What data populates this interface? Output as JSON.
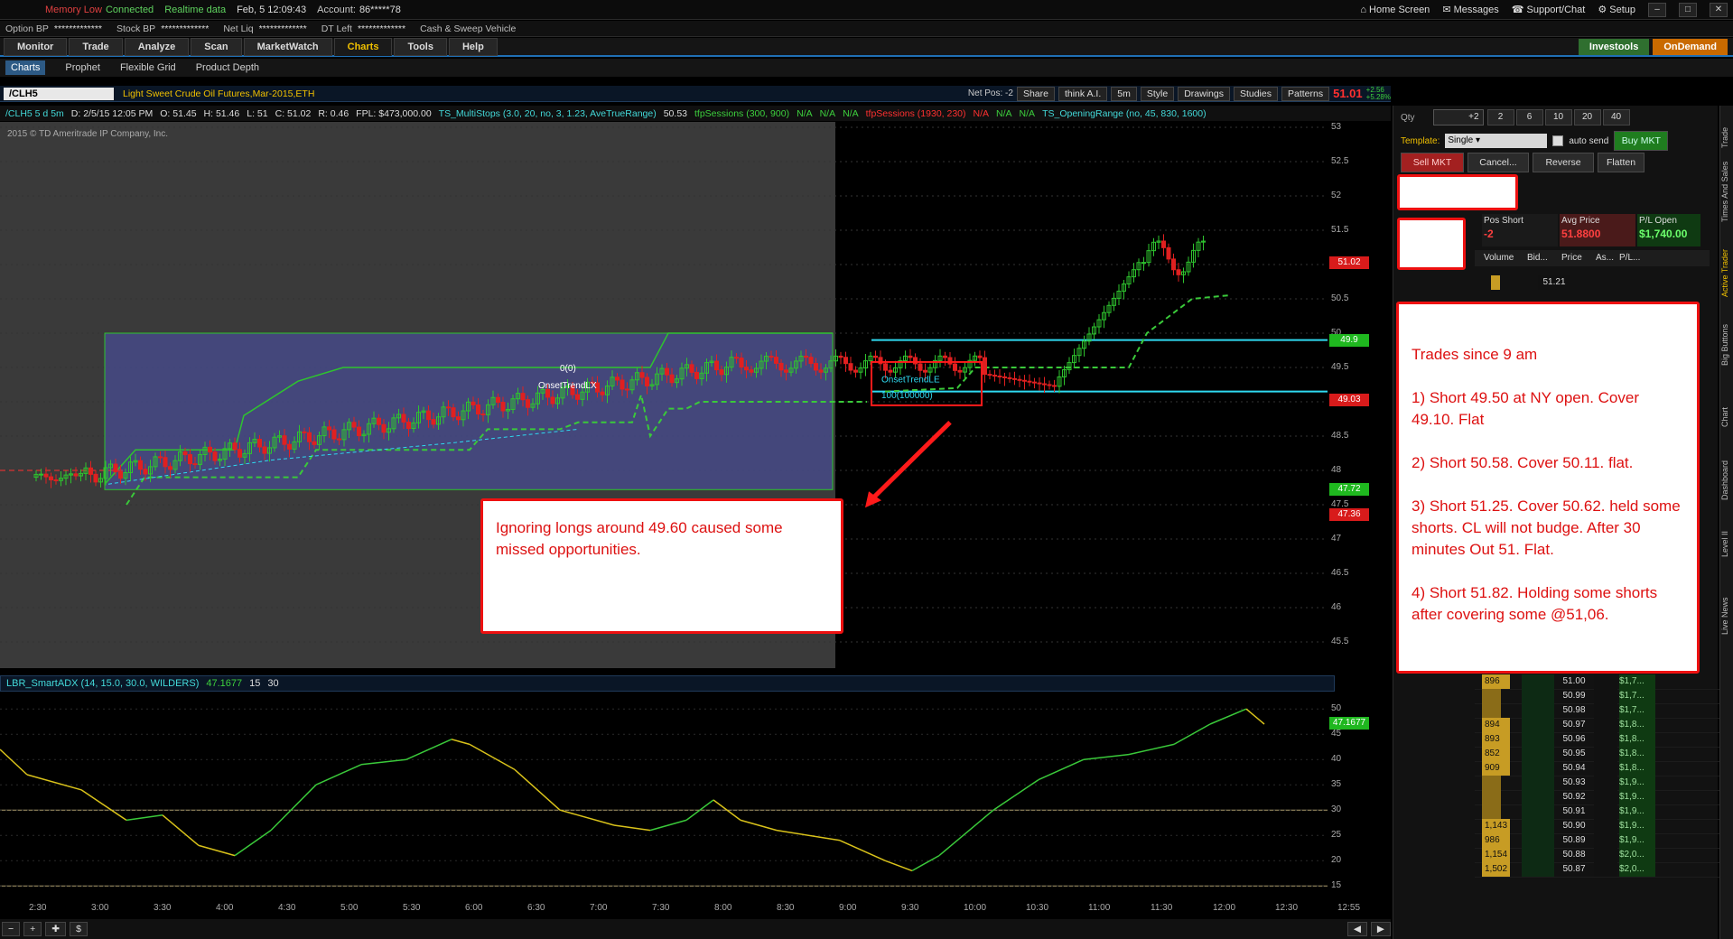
{
  "top_bar": {
    "memory": "Memory Low",
    "connected": "Connected",
    "realtime": "Realtime data",
    "datetime": "Feb, 5  12:09:43",
    "account_label": "Account:",
    "account": "86*****78",
    "home": "Home Screen",
    "messages": "Messages",
    "support": "Support/Chat",
    "setup": "Setup"
  },
  "account_bar": [
    {
      "label": "Option BP",
      "value": "*************"
    },
    {
      "label": "Stock BP",
      "value": "*************"
    },
    {
      "label": "Net Liq",
      "value": "*************"
    },
    {
      "label": "DT Left",
      "value": "*************"
    },
    {
      "label": "Cash & Sweep Vehicle",
      "value": ""
    }
  ],
  "main_tabs": [
    "Monitor",
    "Trade",
    "Analyze",
    "Scan",
    "MarketWatch",
    "Charts",
    "Tools",
    "Help"
  ],
  "active_tab": "Charts",
  "brand": {
    "investools": "Investools",
    "ondemand": "OnDemand"
  },
  "sub_tabs": [
    "Charts",
    "Prophet",
    "Flexible Grid",
    "Product Depth"
  ],
  "symbol_bar": {
    "symbol": "/CLH5",
    "description": "Light Sweet Crude Oil Futures,Mar-2015,ETH",
    "net_pos": "Net Pos: -2",
    "share": "Share",
    "thinkai": "think A.I.",
    "interval": "5m",
    "style": "Style",
    "drawings": "Drawings",
    "studies": "Studies",
    "patterns": "Patterns",
    "last": "51.01",
    "chg1": "+2.56",
    "chg2": "+5.28%"
  },
  "study_bar": {
    "sym": "/CLH5 5 d 5m",
    "d": "D: 2/5/15 12:05 PM",
    "o": "O: 51.45",
    "h": "H: 51.46",
    "l": "L: 51",
    "c": "C: 51.02",
    "r": "R: 0.46",
    "fpl": "FPL: $473,000.00",
    "ts1": "TS_MultiStops (3.0, 20, no, 3, 1.23, AveTrueRange)",
    "ts1v": "50.53",
    "tfp1": "tfpSessions (300, 900)",
    "na": "N/A",
    "tfp2": "tfpSessions (1930, 230)",
    "or": "TS_OpeningRange (no, 45, 830, 1600)"
  },
  "copyright": "2015 © TD Ameritrade IP Company, Inc.",
  "price_axis": [
    "53",
    "52.5",
    "52",
    "51.5",
    "51",
    "50.5",
    "50",
    "49.5",
    "49",
    "48.5",
    "48",
    "47.5",
    "47",
    "46.5",
    "46",
    "45.5"
  ],
  "price_flags": [
    {
      "value": "51.02",
      "color": "#d81b1b",
      "price": 51.02
    },
    {
      "value": "49.9",
      "color": "#1fb81f",
      "price": 49.9
    },
    {
      "value": "49.03",
      "color": "#d81b1b",
      "price": 49.03
    },
    {
      "value": "47.72",
      "color": "#1fb81f",
      "price": 47.72
    },
    {
      "value": "47.36",
      "color": "#d81b1b",
      "price": 47.36
    }
  ],
  "time_axis": [
    "2:30",
    "3:00",
    "3:30",
    "4:00",
    "4:30",
    "5:00",
    "5:30",
    "6:00",
    "6:30",
    "7:00",
    "7:30",
    "8:00",
    "8:30",
    "9:00",
    "9:30",
    "10:00",
    "10:30",
    "11:00",
    "11:30",
    "12:00",
    "12:30",
    "12:55"
  ],
  "chart_labels": {
    "onset_lx": "OnsetTrendLX",
    "zero": "0(0)",
    "onset_le": "OnsetTrendLE",
    "onset_le_qty": "100(100000)"
  },
  "lower_study": {
    "label": "LBR_SmartADX (14, 15.0, 30.0, WILDERS)",
    "value": "47.1677",
    "p1": "15",
    "p2": "30",
    "axis": [
      "50",
      "45",
      "40",
      "35",
      "30",
      "25",
      "20",
      "15"
    ]
  },
  "callout_chart": "Ignoring longs around 49.60 caused some missed opportunities.",
  "callout_trades": [
    "Trades since 9 am",
    "1) Short 49.50 at NY open. Cover 49.10. Flat",
    "2) Short 50.58. Cover 50.11. flat.",
    "3) Short 51.25. Cover 50.62. held some shorts. CL will not budge. After 30 minutes Out 51. Flat.",
    "4) Short 51.82. Holding some shorts after covering some @51,06."
  ],
  "active_trader": {
    "qty_label": "Qty",
    "qty": "+2",
    "qty_buttons": [
      "2",
      "6",
      "10",
      "20",
      "40"
    ],
    "template_label": "Template:",
    "template": "Single",
    "auto_send": "auto send",
    "buy_mkt": "Buy MKT",
    "sell_mkt": "Sell MKT",
    "cancel": "Cancel...",
    "reverse": "Reverse",
    "flatten": "Flatten",
    "pos_label": "Pos Short",
    "pos": "-2",
    "avg_label": "Avg Price",
    "avg": "51.8800",
    "pl_label": "P/L Open",
    "pl": "$1,740.00",
    "ladder_headers": [
      "Volume",
      "Bid...",
      "Price",
      "As...",
      "P/L..."
    ],
    "ladder_top": [
      "51.21"
    ],
    "ladder": [
      {
        "vol": "896",
        "price": "51.00",
        "pl": "$1,7..."
      },
      {
        "vol": "",
        "price": "50.99",
        "pl": "$1,7..."
      },
      {
        "vol": "",
        "price": "50.98",
        "pl": "$1,7..."
      },
      {
        "vol": "894",
        "price": "50.97",
        "pl": "$1,8..."
      },
      {
        "vol": "893",
        "price": "50.96",
        "pl": "$1,8..."
      },
      {
        "vol": "852",
        "price": "50.95",
        "pl": "$1,8..."
      },
      {
        "vol": "909",
        "price": "50.94",
        "pl": "$1,8..."
      },
      {
        "vol": "",
        "price": "50.93",
        "pl": "$1,9..."
      },
      {
        "vol": "",
        "price": "50.92",
        "pl": "$1,9..."
      },
      {
        "vol": "",
        "price": "50.91",
        "pl": "$1,9..."
      },
      {
        "vol": "1,143",
        "price": "50.90",
        "pl": "$1,9..."
      },
      {
        "vol": "986",
        "price": "50.89",
        "pl": "$1,9..."
      },
      {
        "vol": "1,154",
        "price": "50.88",
        "pl": "$2,0..."
      },
      {
        "vol": "1,502",
        "price": "50.87",
        "pl": "$2,0..."
      }
    ]
  },
  "side_tabs": [
    "Trade",
    "Times And Sales",
    "Active Trader",
    "Big Buttons",
    "Chart",
    "Dashboard",
    "Level II",
    "Live News"
  ]
}
